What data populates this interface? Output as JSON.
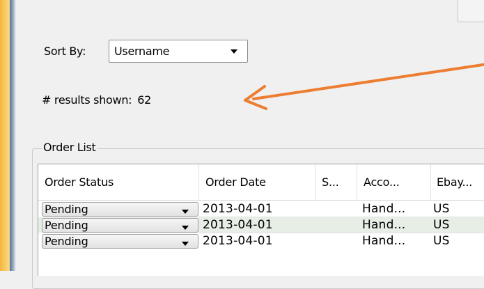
{
  "sort": {
    "label": "Sort By:",
    "value": "Username"
  },
  "results": {
    "label": "# results shown:",
    "count": "62"
  },
  "order_list": {
    "title": "Order List",
    "columns": [
      "Order Status",
      "Order Date",
      "S...",
      "Acco...",
      "Ebay..."
    ],
    "rows": [
      {
        "status": "Pending",
        "date": "2013-04-01",
        "s": "",
        "account": "Hand...",
        "ebay": "US"
      },
      {
        "status": "Pending",
        "date": "2013-04-01",
        "s": "",
        "account": "Hand...",
        "ebay": "US"
      },
      {
        "status": "Pending",
        "date": "2013-04-01",
        "s": "",
        "account": "Hand...",
        "ebay": "US"
      }
    ]
  },
  "colors": {
    "annotation_arrow": "#ed7d31",
    "alt_row": "#e6eee6"
  },
  "icons": [
    "dropdown-arrow-icon",
    "annotation-arrow"
  ]
}
